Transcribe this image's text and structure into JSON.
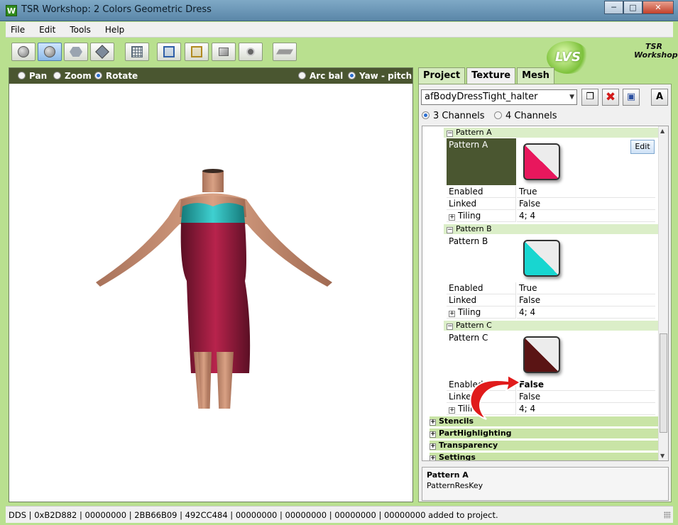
{
  "window": {
    "title": "TSR Workshop: 2 Colors Geometric Dress",
    "app_icon_glyph": "W"
  },
  "menubar": [
    "File",
    "Edit",
    "Tools",
    "Help"
  ],
  "toolbar_icons": [
    "sphere-icon",
    "sphere-shaded-icon",
    "hexagon-icon",
    "diamond-icon",
    "grid-icon",
    "cube-blue-icon",
    "cube-gold-icon",
    "flat-shading-icon",
    "point-icon",
    "plane-icon"
  ],
  "logos": {
    "lvs": "LVS",
    "tsr": "TSR Workshop"
  },
  "viewport": {
    "left_options": [
      {
        "label": "Pan",
        "selected": false
      },
      {
        "label": "Zoom",
        "selected": false
      },
      {
        "label": "Rotate",
        "selected": true
      }
    ],
    "right_options": [
      {
        "label": "Arc bal",
        "selected": false
      },
      {
        "label": "Yaw - pitch",
        "selected": true
      }
    ]
  },
  "tabs": [
    {
      "label": "Project",
      "active": false
    },
    {
      "label": "Texture",
      "active": true
    },
    {
      "label": "Mesh",
      "active": false
    }
  ],
  "texture": {
    "selected_texture": "afBodyDressTight_halter",
    "button_a_label": "A",
    "channels": [
      {
        "label": "3 Channels",
        "selected": true
      },
      {
        "label": "4 Channels",
        "selected": false
      }
    ]
  },
  "patterns": [
    {
      "header": "Pattern A",
      "label": "Pattern A",
      "color": "#e8175d",
      "enabled_label": "Enabled",
      "enabled": "True",
      "linked_label": "Linked",
      "linked": "False",
      "tiling_label": "Tiling",
      "tiling": "4; 4",
      "edit_label": "Edit"
    },
    {
      "header": "Pattern B",
      "label": "Pattern B",
      "color": "#18d6d0",
      "enabled_label": "Enabled",
      "enabled": "True",
      "linked_label": "Linked",
      "linked": "False",
      "tiling_label": "Tiling",
      "tiling": "4; 4"
    },
    {
      "header": "Pattern C",
      "label": "Pattern C",
      "color": "#5a1414",
      "enabled_label": "Enabled",
      "enabled": "False",
      "linked_label": "Linked",
      "linked": "False",
      "tiling_label": "Tiling",
      "tiling": "4; 4"
    }
  ],
  "sections": [
    "Stencils",
    "PartHighlighting",
    "Transparency",
    "Settings"
  ],
  "description": {
    "title": "Pattern A",
    "text": "PatternResKey"
  },
  "status": "DDS | 0xB2D882 | 00000000 | 2BB66B09 | 492CC484 | 00000000 | 00000000 | 00000000 | 00000000 added to project.",
  "colors": {
    "accent_green": "#b9e08f",
    "dark_olive": "#4a5630",
    "section_green": "#dbeec8"
  }
}
